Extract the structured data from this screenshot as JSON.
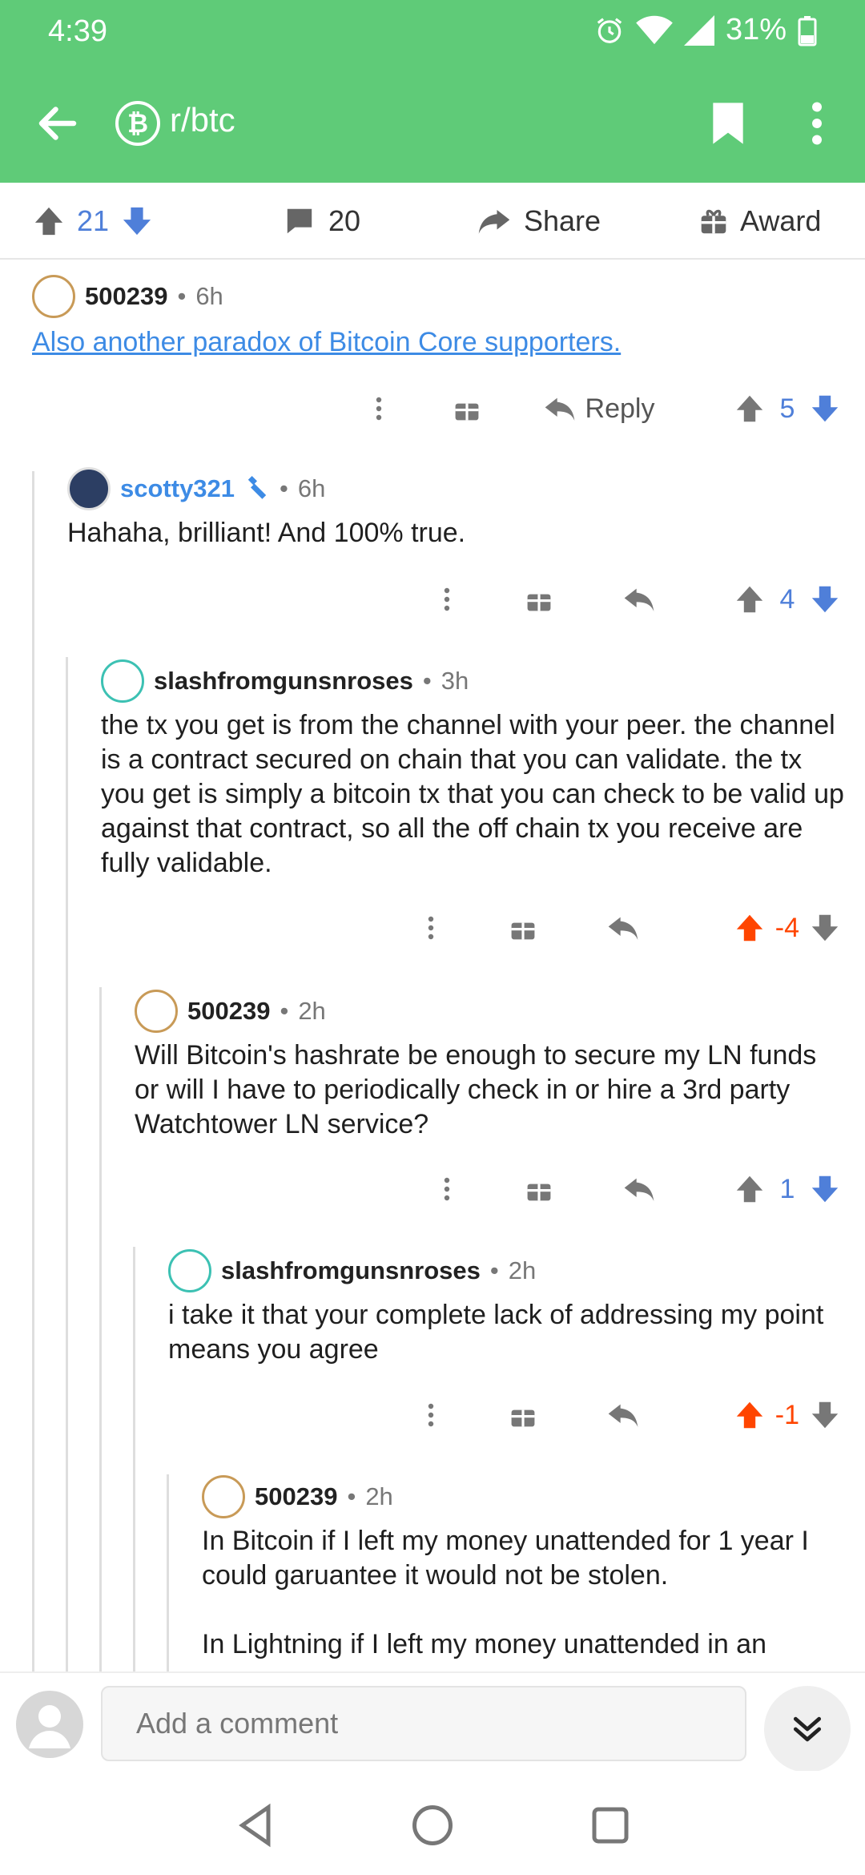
{
  "status_bar": {
    "time": "4:39",
    "battery": "31%"
  },
  "app_bar": {
    "subreddit": "r/btc",
    "subreddit_icon": "₿"
  },
  "post_actions": {
    "votes": "21",
    "comments": "20",
    "share_label": "Share",
    "award_label": "Award"
  },
  "comments": [
    {
      "user": "500239",
      "age": "6h",
      "text": "Also another paradox of Bitcoin Core supporters.",
      "score": "5",
      "reply_label": "Reply"
    },
    {
      "user": "scotty321",
      "age": "6h",
      "text": "Hahaha, brilliant! And 100% true.",
      "score": "4"
    },
    {
      "user": "slashfromgunsnroses",
      "age": "3h",
      "text": "the tx you get is from the channel with your peer. the channel is a contract secured on chain that you can validate. the tx you get is simply a bitcoin tx that you can check to be valid up against that contract, so all the off chain tx you receive are fully validable.",
      "score": "-4"
    },
    {
      "user": "500239",
      "age": "2h",
      "text": "Will Bitcoin's hashrate be enough to secure my LN funds or will I have to periodically check in or hire a 3rd party Watchtower LN service?",
      "score": "1"
    },
    {
      "user": "slashfromgunsnroses",
      "age": "2h",
      "text": "i take it that your complete lack of addressing my point means you agree",
      "score": "-1"
    },
    {
      "user": "500239",
      "age": "2h",
      "text_1": "In Bitcoin if I left my money unattended for 1 year I could garuantee it would not be stolen.",
      "text_2": "In Lightning if I left my money unattended in an"
    }
  ],
  "composer": {
    "placeholder": "Add a comment"
  },
  "colors": {
    "brand": "#5fcb78",
    "upvote": "#ff4500",
    "vote_blue": "#4f7fd9",
    "op_blue": "#3d8be5"
  }
}
